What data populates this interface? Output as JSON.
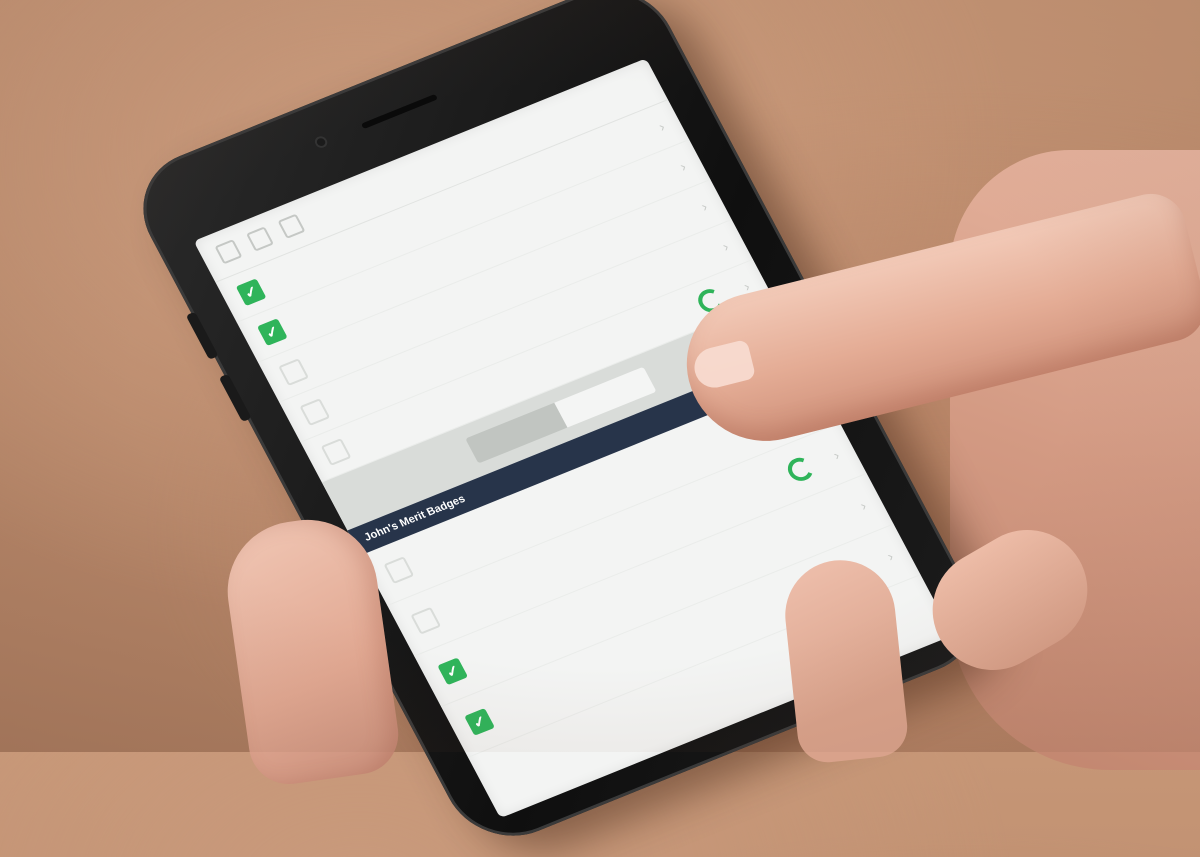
{
  "screen": {
    "header": {
      "title": ""
    },
    "rows": [
      {
        "label": "",
        "checked": true,
        "meta": "",
        "icon": "check-icon"
      },
      {
        "label": "",
        "checked": true,
        "meta": "",
        "icon": "check-icon"
      },
      {
        "label": "",
        "checked": false,
        "meta": "",
        "icon": ""
      },
      {
        "label": "",
        "checked": false,
        "meta": "",
        "icon": ""
      },
      {
        "label": "",
        "checked": false,
        "meta": "",
        "icon": "progress-ring-icon"
      }
    ],
    "tabs": [
      {
        "label": ""
      },
      {
        "label": ""
      }
    ],
    "section_title": "John's Merit Badges",
    "badge_rows": [
      {
        "label": "",
        "sub": "",
        "meta": ""
      },
      {
        "label": "",
        "sub": "",
        "meta": ""
      },
      {
        "label": "",
        "sub": "",
        "meta": ""
      },
      {
        "label": "",
        "sub": "",
        "meta": ""
      }
    ]
  },
  "colors": {
    "accent_green": "#2fb45a",
    "section_navy": "#27344a",
    "background_warm": "#c69676"
  }
}
